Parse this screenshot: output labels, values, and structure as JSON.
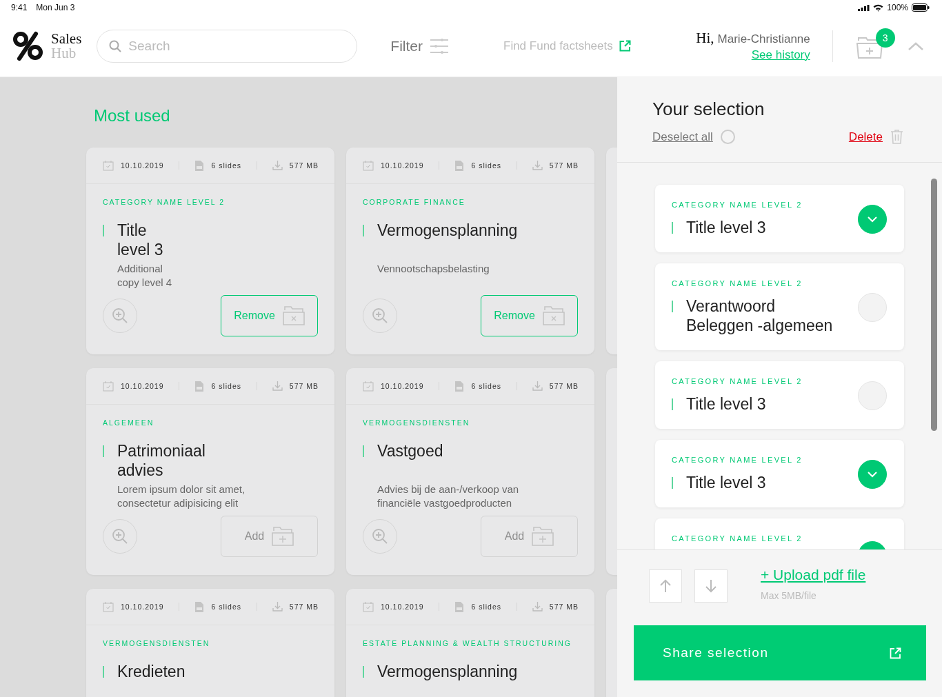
{
  "status_bar": {
    "time": "9:41",
    "date": "Mon Jun 3",
    "battery": "100%"
  },
  "header": {
    "logo_top": "Sales",
    "logo_bottom": "Hub",
    "search": {
      "placeholder": "Search"
    },
    "filter": "Filter",
    "factsheets_link": "Find Fund factsheets",
    "greeting": "Hi,",
    "user_name": "Marie-Christianne",
    "history_link": "See history",
    "cart_count": "3"
  },
  "main": {
    "heading": "Most used",
    "cards": [
      {
        "date": "10.10.2019",
        "slides": "6 slides",
        "size": "577 MB",
        "category": "CATEGORY NAME LEVEL 2",
        "title": "Title\nlevel 3",
        "description": "Additional\ncopy level 4",
        "action": {
          "kind": "remove",
          "label": "Remove"
        }
      },
      {
        "date": "10.10.2019",
        "slides": "6 slides",
        "size": "577 MB",
        "category": "CORPORATE FINANCE",
        "title": "Vermogensplanning",
        "description": "Vennootschapsbelasting",
        "action": {
          "kind": "remove",
          "label": "Remove"
        }
      },
      {
        "date": "10.10.2019",
        "slides": "6 slides",
        "size": "577 MB",
        "category": "ALGEMEEN",
        "title": "Patrimoniaal\nadvies",
        "description": "Lorem ipsum dolor sit amet,\nconsectetur adipisicing elit",
        "action": {
          "kind": "add",
          "label": "Add"
        }
      },
      {
        "date": "10.10.2019",
        "slides": "6 slides",
        "size": "577 MB",
        "category": "VERMOGENSDIENSTEN",
        "title": "Vastgoed",
        "description": "Advies bij de aan-/verkoop van\nfinanciële vastgoedproducten",
        "action": {
          "kind": "add",
          "label": "Add"
        }
      },
      {
        "date": "10.10.2019",
        "slides": "6 slides",
        "size": "577 MB",
        "category": "VERMOGENSDIENSTEN",
        "title": "Kredieten"
      },
      {
        "date": "10.10.2019",
        "slides": "6 slides",
        "size": "577 MB",
        "category": "ESTATE PLANNING & WEALTH STRUCTURING",
        "title": "Vermogensplanning"
      }
    ]
  },
  "selection": {
    "title": "Your selection",
    "deselect_all": "Deselect all",
    "delete": "Delete",
    "items": [
      {
        "category": "CATEGORY NAME LEVEL 2",
        "title": "Title level 3",
        "selected": true
      },
      {
        "category": "CATEGORY NAME LEVEL 2",
        "title": "Verantwoord\nBeleggen -algemeen",
        "selected": false
      },
      {
        "category": "CATEGORY NAME LEVEL 2",
        "title": "Title level 3",
        "selected": false
      },
      {
        "category": "CATEGORY NAME LEVEL 2",
        "title": "Title level 3",
        "selected": true
      },
      {
        "category": "CATEGORY NAME LEVEL 2",
        "selected": true
      }
    ],
    "upload_link": "+ Upload pdf file",
    "upload_hint": "Max 5MB/file",
    "share_button": "Share selection"
  }
}
